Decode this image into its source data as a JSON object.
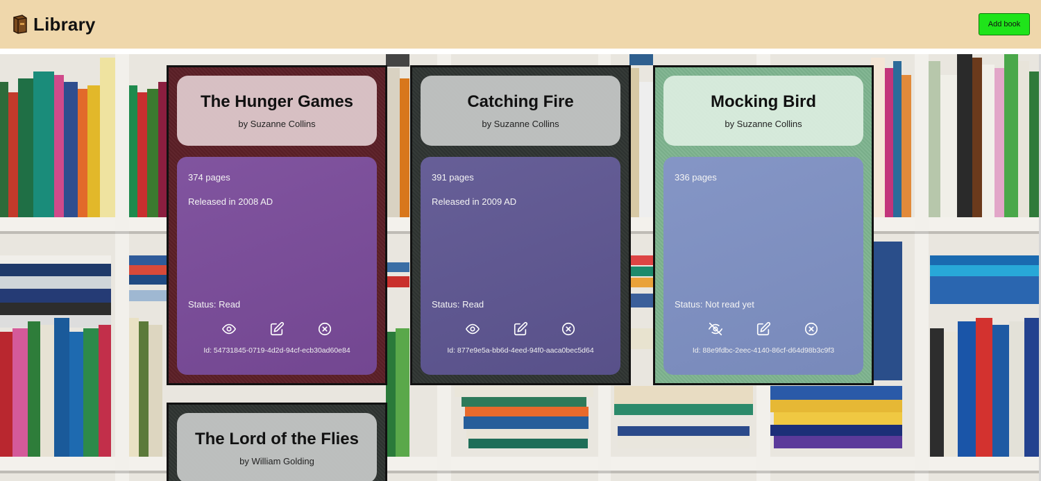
{
  "header": {
    "title": "Library",
    "logo_icon": "book-icon",
    "add_button": "Add book",
    "background": "#efd7ab",
    "add_button_color": "#1fe41a"
  },
  "books": [
    {
      "title": "The Hunger Games",
      "author": "by Suzanne Collins",
      "pages": "374 pages",
      "released": "Released in 2008 AD",
      "status": "Status: Read",
      "id": "Id: 54731845-0719-4d2d-94cf-ecb30ad60e84",
      "view_icon": "eye-icon",
      "cover_color": "#5b1f26"
    },
    {
      "title": "Catching Fire",
      "author": "by Suzanne Collins",
      "pages": "391 pages",
      "released": "Released in 2009 AD",
      "status": "Status: Read",
      "id": "Id: 877e9e5a-bb6d-4eed-94f0-aaca0bec5d64",
      "view_icon": "eye-icon",
      "cover_color": "#2f3532"
    },
    {
      "title": "Mocking Bird",
      "author": "by Suzanne Collins",
      "pages": "336 pages",
      "released": "",
      "status": "Status: Not read yet",
      "id": "Id: 88e9fdbc-2eec-4140-86cf-d64d98b3c9f3",
      "view_icon": "eye-off-icon",
      "cover_color": "#7db38e"
    },
    {
      "title": "The Lord of the Flies",
      "author": "by William Golding",
      "cover_color": "#2f3532"
    }
  ]
}
